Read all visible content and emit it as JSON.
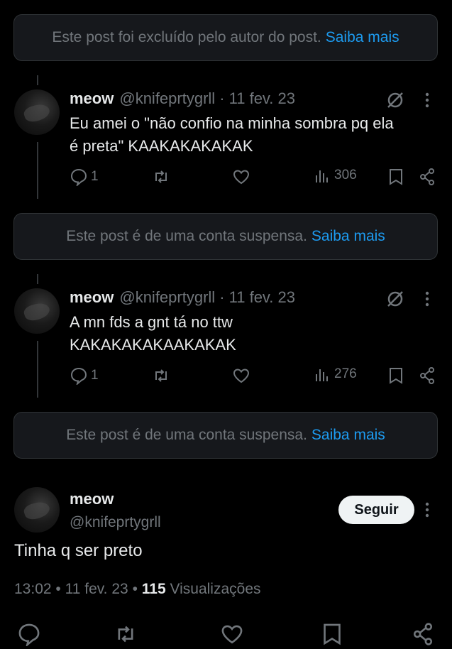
{
  "notices": [
    {
      "text": "Este post foi excluído pelo autor do post.",
      "link": "Saiba mais"
    },
    {
      "text": "Este post é de uma conta suspensa.",
      "link": "Saiba mais"
    },
    {
      "text": "Este post é de uma conta suspensa.",
      "link": "Saiba mais"
    }
  ],
  "posts": [
    {
      "name": "meow",
      "handle": "@knifeprtygrll",
      "date": "· 11 fev. 23",
      "text": "Eu amei o \"não confio na minha sombra pq ela\né preta\" KAAKAKAKAKAK",
      "replies": "1",
      "views": "306"
    },
    {
      "name": "meow",
      "handle": "@knifeprtygrll",
      "date": "· 11 fev. 23",
      "text": "A mn fds a gnt tá no ttw\nKAKAKAKAKAAKAKAK",
      "replies": "1",
      "views": "276"
    }
  ],
  "main": {
    "name": "meow",
    "handle": "@knifeprtygrll",
    "follow_label": "Seguir",
    "text": "Tinha q ser preto",
    "time": "13:02",
    "date": "11 fev. 23",
    "views_count": "115",
    "views_label": "Visualizações"
  },
  "colors": {
    "accent": "#1d9bf0",
    "muted": "#71767b",
    "text": "#e7e9ea",
    "background": "#000000"
  }
}
